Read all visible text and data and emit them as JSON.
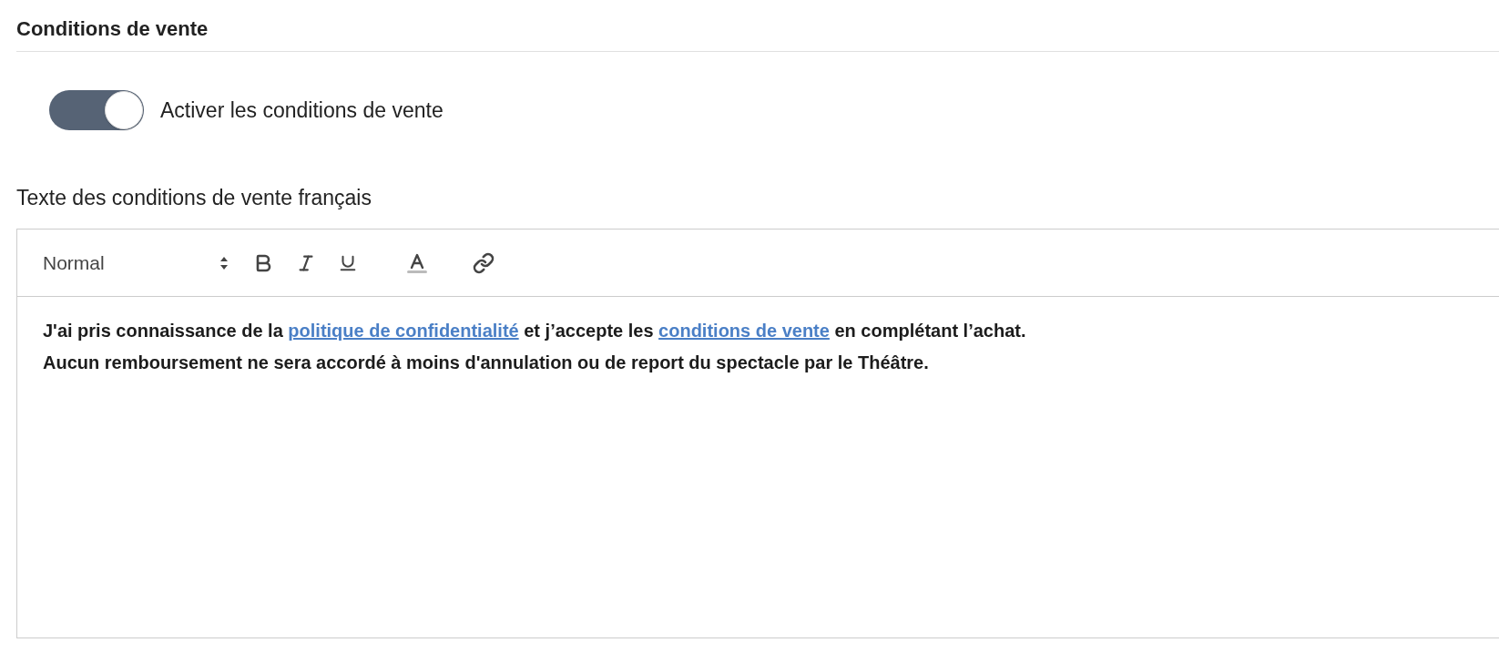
{
  "section": {
    "title": "Conditions de vente"
  },
  "toggle": {
    "label": "Activer les conditions de vente",
    "on": true
  },
  "editor": {
    "label": "Texte des conditions de vente français",
    "format_select": {
      "value": "Normal"
    },
    "paragraphs": [
      {
        "segments": [
          {
            "kind": "text",
            "text": "J'ai pris connaissance de la "
          },
          {
            "kind": "link",
            "text": "politique de confidentialité"
          },
          {
            "kind": "text",
            "text": " et j’accepte les "
          },
          {
            "kind": "link",
            "text": "conditions de vente"
          },
          {
            "kind": "text",
            "text": " en complétant l’achat."
          }
        ]
      },
      {
        "segments": [
          {
            "kind": "text",
            "text": "Aucun remboursement ne sera accordé à moins d'annulation ou de report du spectacle par le Théâtre."
          }
        ]
      }
    ]
  }
}
